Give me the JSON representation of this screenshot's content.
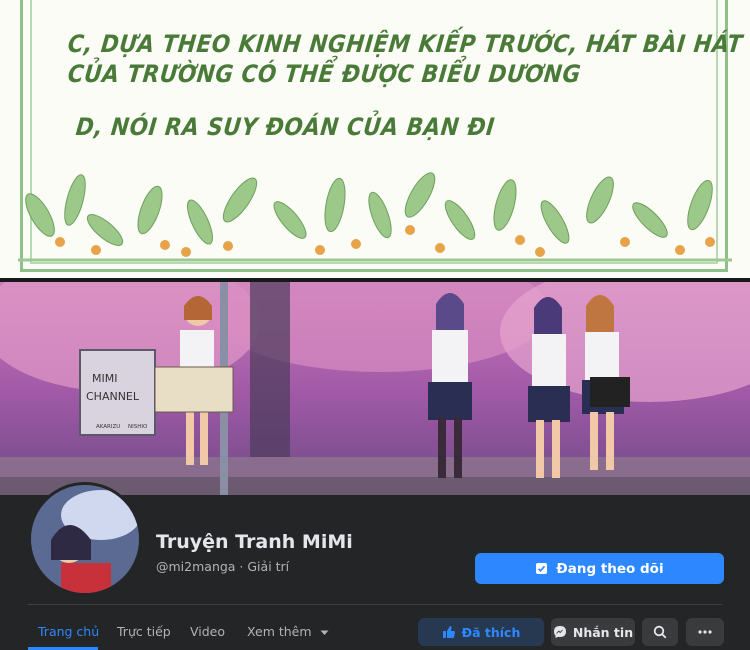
{
  "manga": {
    "line1": "C, DỰA THEO KINH NGHIỆM KIẾP TRƯỚC, HÁT BÀI HÁT",
    "line2": "CỦA TRƯỜNG CÓ THỂ ĐƯỢC BIỂU DƯƠNG",
    "line3": "D, NÓI RA SUY ĐOÁN CỦA BẠN ĐI"
  },
  "cover": {
    "sign_line1": "MIMI",
    "sign_line2": "CHANNEL",
    "sign_sub1": "AKARIZU",
    "sign_sub2": "NISHIO"
  },
  "profile": {
    "name": "Truyện Tranh MiMi",
    "meta": "@mi2manga · Giải trí",
    "follow_label": "Đang theo dõi"
  },
  "nav": {
    "tabs": [
      "Trang chủ",
      "Trực tiếp",
      "Video",
      "Xem thêm"
    ],
    "like_label": "Đã thích",
    "message_label": "Nhắn tin"
  },
  "colors": {
    "accent": "#2d88ff",
    "background": "#242526",
    "text_green": "#4a7a38"
  }
}
